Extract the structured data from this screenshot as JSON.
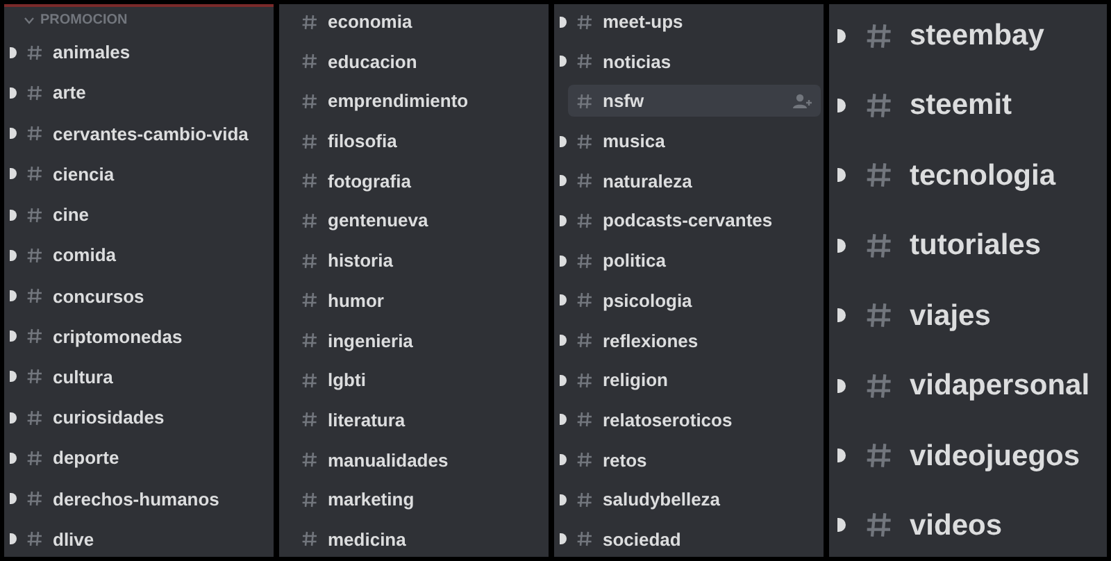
{
  "panels": [
    {
      "kind": "small",
      "header": "PROMOCION",
      "channels": [
        {
          "name": "animales",
          "unread": true,
          "selected": false
        },
        {
          "name": "arte",
          "unread": true,
          "selected": false
        },
        {
          "name": "cervantes-cambio-vida",
          "unread": true,
          "selected": false
        },
        {
          "name": "ciencia",
          "unread": true,
          "selected": false
        },
        {
          "name": "cine",
          "unread": true,
          "selected": false
        },
        {
          "name": "comida",
          "unread": true,
          "selected": false
        },
        {
          "name": "concursos",
          "unread": true,
          "selected": false
        },
        {
          "name": "criptomonedas",
          "unread": true,
          "selected": false
        },
        {
          "name": "cultura",
          "unread": true,
          "selected": false
        },
        {
          "name": "curiosidades",
          "unread": true,
          "selected": false
        },
        {
          "name": "deporte",
          "unread": true,
          "selected": false
        },
        {
          "name": "derechos-humanos",
          "unread": true,
          "selected": false
        },
        {
          "name": "dlive",
          "unread": true,
          "selected": false
        }
      ]
    },
    {
      "kind": "small",
      "channels": [
        {
          "name": "economia",
          "unread": false,
          "selected": false
        },
        {
          "name": "educacion",
          "unread": false,
          "selected": false
        },
        {
          "name": "emprendimiento",
          "unread": false,
          "selected": false
        },
        {
          "name": "filosofia",
          "unread": false,
          "selected": false
        },
        {
          "name": "fotografia",
          "unread": false,
          "selected": false
        },
        {
          "name": "gentenueva",
          "unread": false,
          "selected": false
        },
        {
          "name": "historia",
          "unread": false,
          "selected": false
        },
        {
          "name": "humor",
          "unread": false,
          "selected": false
        },
        {
          "name": "ingenieria",
          "unread": false,
          "selected": false
        },
        {
          "name": "lgbti",
          "unread": false,
          "selected": false
        },
        {
          "name": "literatura",
          "unread": false,
          "selected": false
        },
        {
          "name": "manualidades",
          "unread": false,
          "selected": false
        },
        {
          "name": "marketing",
          "unread": false,
          "selected": false
        },
        {
          "name": "medicina",
          "unread": false,
          "selected": false
        }
      ]
    },
    {
      "kind": "small",
      "channels": [
        {
          "name": "meet-ups",
          "unread": true,
          "selected": false
        },
        {
          "name": "noticias",
          "unread": true,
          "selected": false
        },
        {
          "name": "nsfw",
          "unread": false,
          "selected": true
        },
        {
          "name": "musica",
          "unread": true,
          "selected": false
        },
        {
          "name": "naturaleza",
          "unread": true,
          "selected": false
        },
        {
          "name": "podcasts-cervantes",
          "unread": true,
          "selected": false
        },
        {
          "name": "politica",
          "unread": true,
          "selected": false
        },
        {
          "name": "psicologia",
          "unread": true,
          "selected": false
        },
        {
          "name": "reflexiones",
          "unread": true,
          "selected": false
        },
        {
          "name": "religion",
          "unread": true,
          "selected": false
        },
        {
          "name": "relatoseroticos",
          "unread": true,
          "selected": false
        },
        {
          "name": "retos",
          "unread": true,
          "selected": false
        },
        {
          "name": "saludybelleza",
          "unread": true,
          "selected": false
        },
        {
          "name": "sociedad",
          "unread": true,
          "selected": false
        }
      ]
    },
    {
      "kind": "large",
      "channels": [
        {
          "name": "steembay",
          "unread": true,
          "selected": false
        },
        {
          "name": "steemit",
          "unread": true,
          "selected": false
        },
        {
          "name": "tecnologia",
          "unread": true,
          "selected": false
        },
        {
          "name": "tutoriales",
          "unread": true,
          "selected": false
        },
        {
          "name": "viajes",
          "unread": true,
          "selected": false
        },
        {
          "name": "vidapersonal",
          "unread": true,
          "selected": false
        },
        {
          "name": "videojuegos",
          "unread": true,
          "selected": false
        },
        {
          "name": "videos",
          "unread": true,
          "selected": false
        }
      ]
    }
  ]
}
